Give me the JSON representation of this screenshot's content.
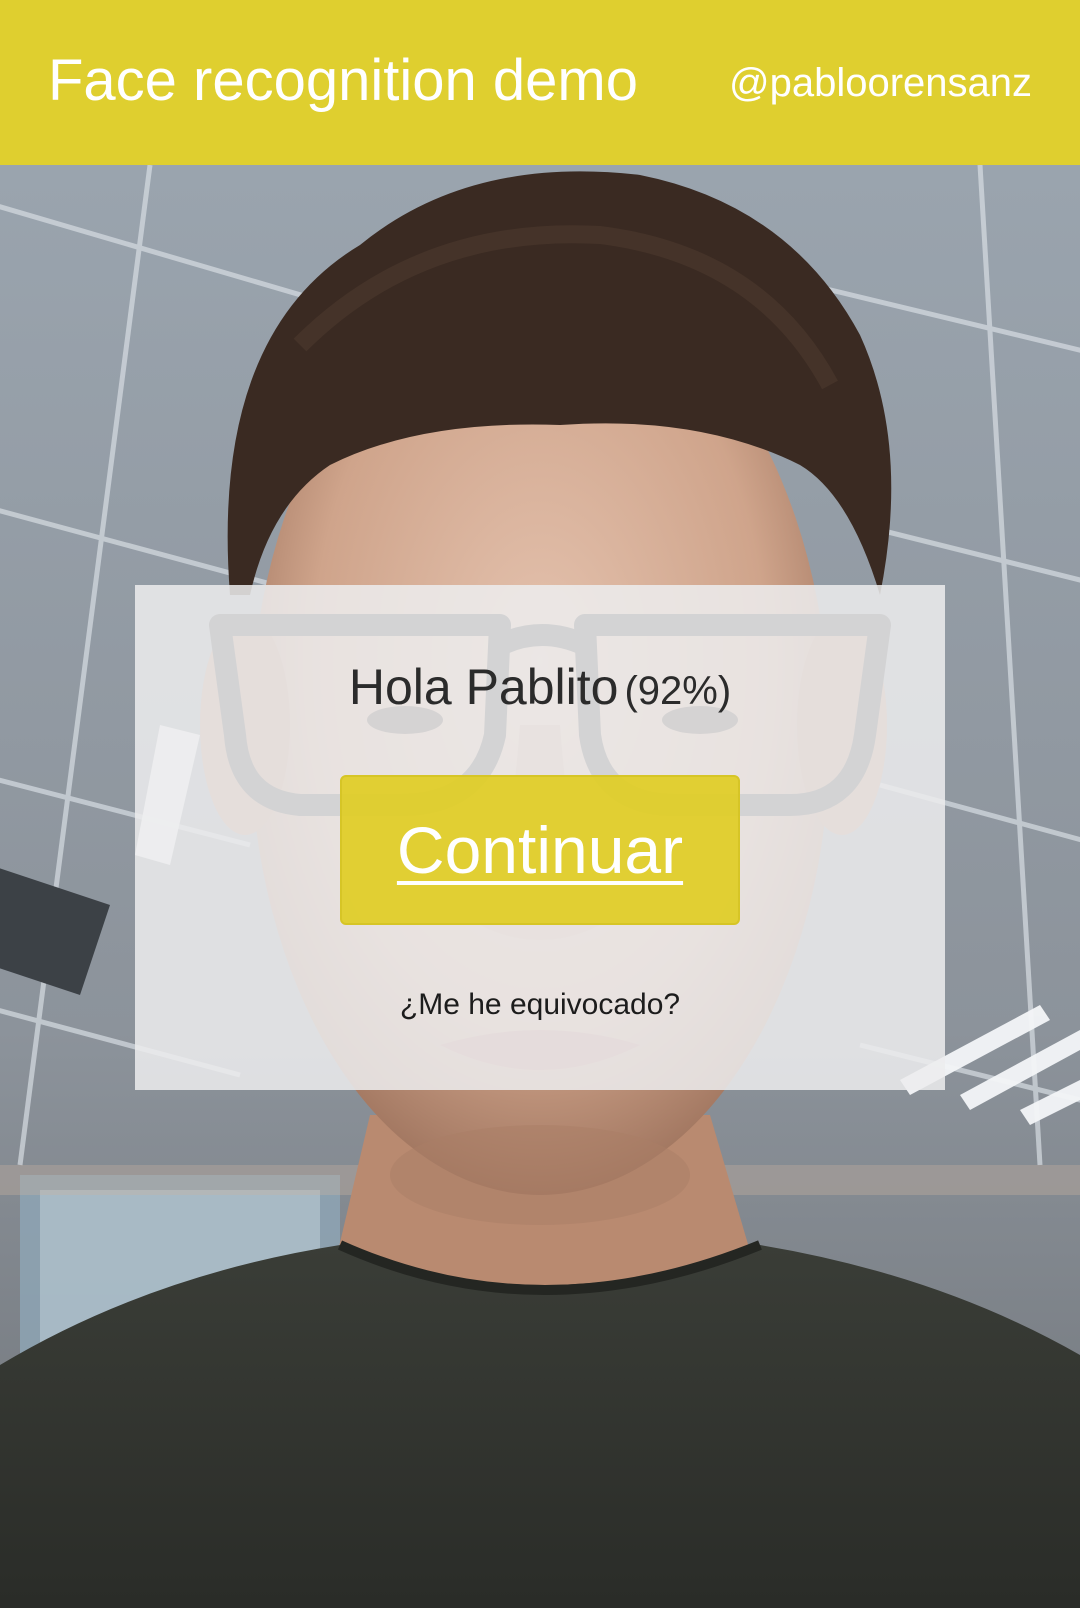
{
  "header": {
    "title": "Face recognition demo",
    "author": "@pabloorensanz"
  },
  "camera": {
    "description_icon": "camera-feed-photo"
  },
  "result": {
    "greeting": "Hola Pablito",
    "confidence": "(92%)",
    "continue_label": "Continuar",
    "mistake_label": "¿Me he equivocado?"
  },
  "colors": {
    "header_background": "#dfcf2f",
    "button_background": "#dfcd24",
    "header_text": "#ffffff",
    "card_background": "#ececee"
  }
}
